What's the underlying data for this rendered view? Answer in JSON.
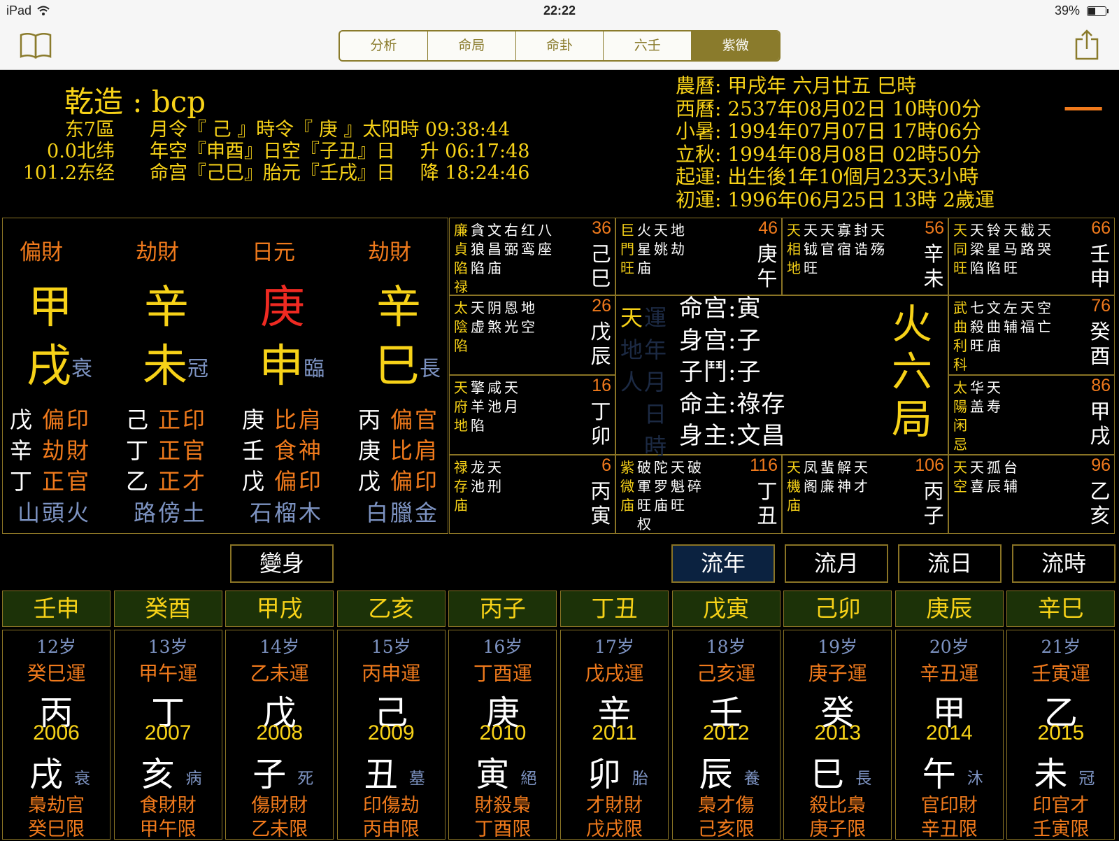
{
  "status_bar": {
    "device": "iPad",
    "time": "22:22",
    "battery": "39%"
  },
  "tabs": [
    "分析",
    "命局",
    "命卦",
    "六壬",
    "紫微"
  ],
  "active_tab": "紫微",
  "header": {
    "title": "乾造 : bcp",
    "rows": [
      [
        "东7區",
        "月令『 己 』時令『 庚 』太阳時 09:38:44"
      ],
      [
        "0.0北纬",
        "年空『申酉』日空『子丑』日　 升 06:17:48"
      ],
      [
        "101.2东经",
        "命宫『己巳』胎元『壬戌』日　 降 18:24:46"
      ]
    ],
    "dates": [
      "農曆: 甲戌年 六月廿五 巳時",
      "西曆: 2537年08月02日 10時00分",
      "小暑: 1994年07月07日 17時06分",
      "立秋: 1994年08月08日 02時50分",
      "起運: 出生後1年10個月23天3小時",
      "初運: 1996年06月25日 13時 2歲運"
    ],
    "mark": "一"
  },
  "pillars": [
    {
      "god": "偏財",
      "stem": "甲",
      "branch": "戌",
      "phase": "衰",
      "hidden": [
        [
          "戊",
          "偏印"
        ],
        [
          "辛",
          "劫財"
        ],
        [
          "丁",
          "正官"
        ]
      ],
      "nayin": "山頭火"
    },
    {
      "god": "劫財",
      "stem": "辛",
      "branch": "未",
      "phase": "冠",
      "hidden": [
        [
          "己",
          "正印"
        ],
        [
          "丁",
          "正官"
        ],
        [
          "乙",
          "正才"
        ]
      ],
      "nayin": "路傍土"
    },
    {
      "god": "日元",
      "stem": "庚",
      "branch": "申",
      "phase": "臨",
      "hidden": [
        [
          "庚",
          "比肩"
        ],
        [
          "壬",
          "食神"
        ],
        [
          "戊",
          "偏印"
        ]
      ],
      "nayin": "石榴木"
    },
    {
      "god": "劫財",
      "stem": "辛",
      "branch": "巳",
      "phase": "長",
      "hidden": [
        [
          "丙",
          "偏官"
        ],
        [
          "庚",
          "比肩"
        ],
        [
          "戊",
          "偏印"
        ]
      ],
      "nayin": "白臘金"
    }
  ],
  "palaces": [
    {
      "num": "36",
      "gz": "己巳",
      "stars": "廉貪文右红八\n貞狼昌弼鸾座\n陷陷庙\n禄"
    },
    {
      "num": "46",
      "gz": "庚午",
      "stars": "巨火天地\n門星姚劫\n旺庙"
    },
    {
      "num": "56",
      "gz": "辛未",
      "stars": "天天天寡封天\n相钺官宿诰殇\n地旺"
    },
    {
      "num": "66",
      "gz": "壬申",
      "stars": "天天铃天截天\n同梁星马路哭\n旺陷陷旺"
    },
    {
      "num": "26",
      "gz": "戊辰",
      "stars": "太天阴恩地\n陰虚煞光空\n陷"
    },
    {
      "num": "76",
      "gz": "癸酉",
      "stars": "武七文左天空\n曲殺曲辅福亡\n利旺庙\n科"
    },
    {
      "num": "16",
      "gz": "丁卯",
      "stars": "天擎咸天\n府羊池月\n地陷"
    },
    {
      "num": "86",
      "gz": "甲戌",
      "stars": "太华天\n陽盖寿\n闲\n忌"
    },
    {
      "num": "6",
      "gz": "丙寅",
      "stars": "禄龙天\n存池刑\n庙"
    },
    {
      "num": "116",
      "gz": "丁丑",
      "stars": "紫破陀天破\n微軍罗魁碎\n庙旺庙旺\n　权"
    },
    {
      "num": "106",
      "gz": "丙子",
      "stars": "天凤蜚解天\n機阁廉神才\n庙"
    },
    {
      "num": "96",
      "gz": "乙亥",
      "stars": "天天孤台\n空喜辰辅"
    }
  ],
  "center": {
    "side_a": [
      "天",
      "地",
      "人"
    ],
    "side_b": [
      "運",
      "年",
      "月",
      "日",
      "時"
    ],
    "lines": [
      "命宫:寅",
      "身宫:子",
      "子鬥:子",
      "命主:祿存",
      "身主:文昌"
    ],
    "ju": [
      "火",
      "六",
      "局"
    ]
  },
  "buttons": {
    "transform": "變身",
    "liunian": "流年",
    "liuyue": "流月",
    "liuri": "流日",
    "liushi": "流時"
  },
  "flow_years": [
    {
      "gz": "壬申",
      "age": "12岁",
      "yun": "癸巳運",
      "stem": "丙",
      "year": "2006",
      "branch": "戌",
      "phase": "衰",
      "ss": "梟劫官",
      "xian": "癸巳限"
    },
    {
      "gz": "癸酉",
      "age": "13岁",
      "yun": "甲午運",
      "stem": "丁",
      "year": "2007",
      "branch": "亥",
      "phase": "病",
      "ss": "食財財",
      "xian": "甲午限"
    },
    {
      "gz": "甲戌",
      "age": "14岁",
      "yun": "乙未運",
      "stem": "戊",
      "year": "2008",
      "branch": "子",
      "phase": "死",
      "ss": "傷財財",
      "xian": "乙未限"
    },
    {
      "gz": "乙亥",
      "age": "15岁",
      "yun": "丙申運",
      "stem": "己",
      "year": "2009",
      "branch": "丑",
      "phase": "墓",
      "ss": "印傷劫",
      "xian": "丙申限"
    },
    {
      "gz": "丙子",
      "age": "16岁",
      "yun": "丁酉運",
      "stem": "庚",
      "year": "2010",
      "branch": "寅",
      "phase": "絕",
      "ss": "財殺梟",
      "xian": "丁酉限"
    },
    {
      "gz": "丁丑",
      "age": "17岁",
      "yun": "戊戌運",
      "stem": "辛",
      "year": "2011",
      "branch": "卯",
      "phase": "胎",
      "ss": "才財財",
      "xian": "戊戌限"
    },
    {
      "gz": "戊寅",
      "age": "18岁",
      "yun": "己亥運",
      "stem": "壬",
      "year": "2012",
      "branch": "辰",
      "phase": "養",
      "ss": "梟才傷",
      "xian": "己亥限"
    },
    {
      "gz": "己卯",
      "age": "19岁",
      "yun": "庚子運",
      "stem": "癸",
      "year": "2013",
      "branch": "巳",
      "phase": "長",
      "ss": "殺比梟",
      "xian": "庚子限"
    },
    {
      "gz": "庚辰",
      "age": "20岁",
      "yun": "辛丑運",
      "stem": "甲",
      "year": "2014",
      "branch": "午",
      "phase": "沐",
      "ss": "官印財",
      "xian": "辛丑限"
    },
    {
      "gz": "辛巳",
      "age": "21岁",
      "yun": "壬寅運",
      "stem": "乙",
      "year": "2015",
      "branch": "未",
      "phase": "冠",
      "ss": "印官才",
      "xian": "壬寅限"
    }
  ]
}
